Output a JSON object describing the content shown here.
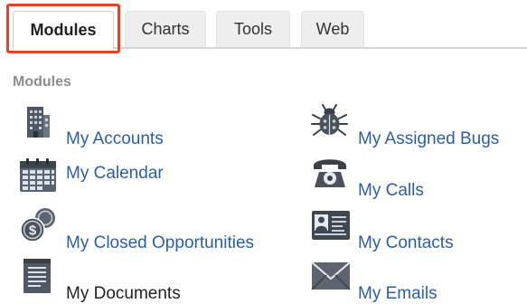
{
  "tabs": [
    {
      "label": "Modules",
      "active": true
    },
    {
      "label": "Charts",
      "active": false
    },
    {
      "label": "Tools",
      "active": false
    },
    {
      "label": "Web",
      "active": false
    }
  ],
  "section_label": "Modules",
  "modules": {
    "my_accounts": {
      "label": "My Accounts",
      "icon": "building-icon"
    },
    "my_assigned_bugs": {
      "label": "My Assigned Bugs",
      "icon": "bug-icon"
    },
    "my_calendar": {
      "label": "My Calendar",
      "icon": "calendar-icon"
    },
    "my_calls": {
      "label": "My Calls",
      "icon": "phone-icon"
    },
    "my_closed_opportunities": {
      "label": "My Closed Opportunities",
      "icon": "coins-icon"
    },
    "my_contacts": {
      "label": "My Contacts",
      "icon": "contact-card-icon"
    },
    "my_documents": {
      "label": "My Documents",
      "icon": "document-icon"
    },
    "my_emails": {
      "label": "My Emails",
      "icon": "envelope-icon"
    }
  },
  "colors": {
    "link": "#2c5ea8",
    "highlight": "#e8412b",
    "section_label": "#8c8c8c",
    "tab_bg": "#eeeeee"
  }
}
